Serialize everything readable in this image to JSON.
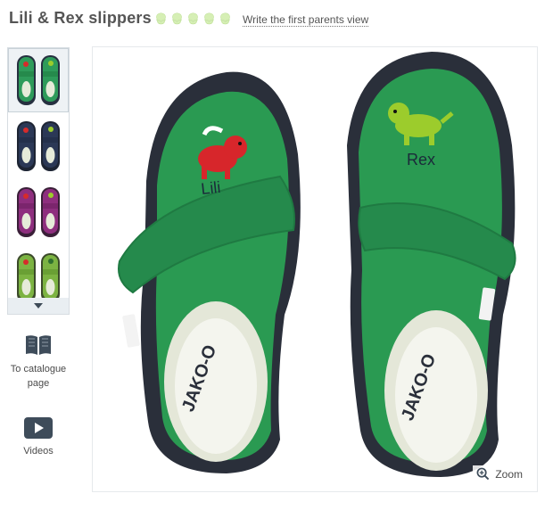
{
  "product": {
    "title": "Lili & Rex slippers",
    "rating_icons": [
      "rating-icon",
      "rating-icon",
      "rating-icon",
      "rating-icon",
      "rating-icon"
    ],
    "review_link": "Write the first parents view"
  },
  "gallery": {
    "thumbnails": [
      {
        "color_name": "green",
        "color": "#2e9b5a"
      },
      {
        "color_name": "navy",
        "color": "#2b3856"
      },
      {
        "color_name": "purple",
        "color": "#8e2e7e"
      },
      {
        "color_name": "lime",
        "color": "#7cb342"
      }
    ],
    "scroll_icon": "chevron-down-icon"
  },
  "actions": {
    "catalogue_label": "To catalogue page",
    "catalogue_icon": "open-book-icon",
    "videos_label": "Videos",
    "videos_icon": "play-icon"
  },
  "main_image": {
    "left_dog_text": "Lili",
    "right_dog_text": "Rex",
    "brand_text": "JAKO-O",
    "shoe_color": "#2a9a52",
    "sole_color": "#2a2f3a",
    "zoom_label": "Zoom",
    "zoom_icon": "zoom-in-icon"
  }
}
